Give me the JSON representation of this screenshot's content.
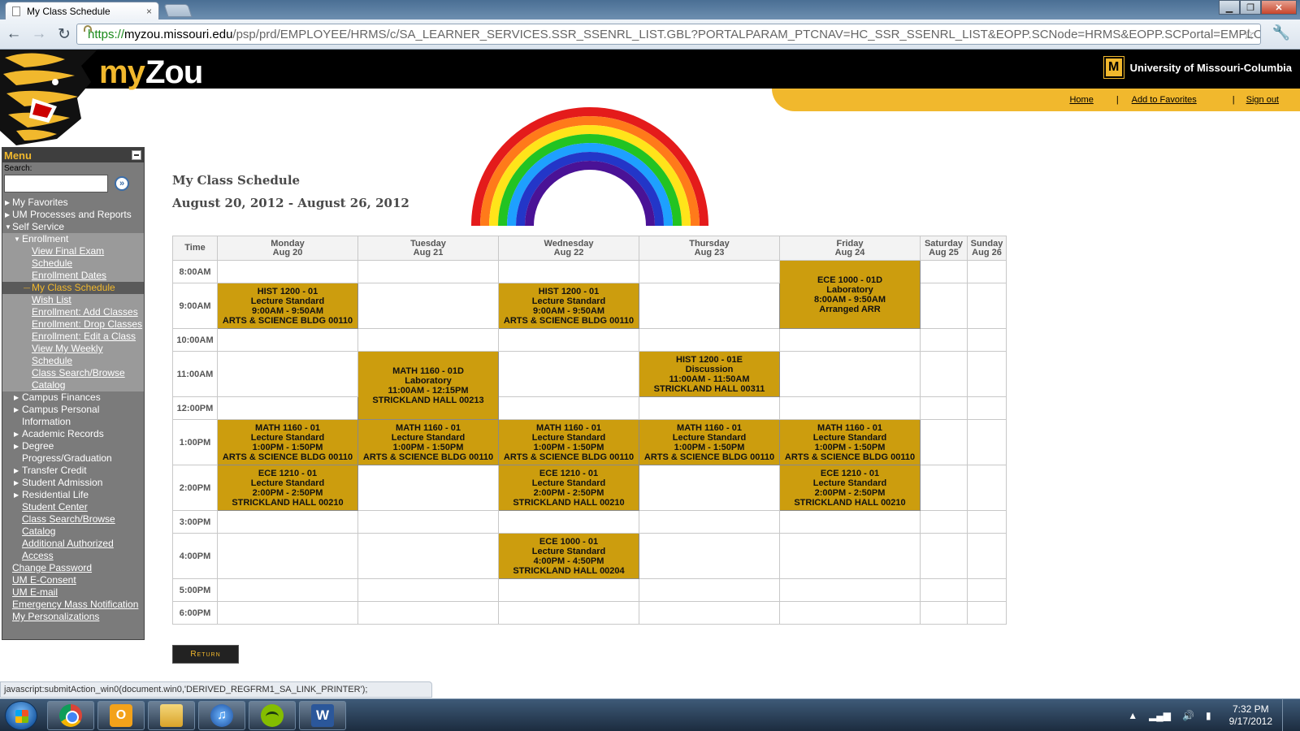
{
  "browser": {
    "tab_title": "My Class Schedule",
    "tab_close": "×",
    "url_scheme": "https://",
    "url_host": "myzou.missouri.edu",
    "url_path": "/psp/prd/EMPLOYEE/HRMS/c/SA_LEARNER_SERVICES.SSR_SSENRL_LIST.GBL?PORTALPARAM_PTCNAV=HC_SSR_SSENRL_LIST&EOPP.SCNode=HRMS&EOPP.SCPortal=EMPLOYEE&EOPP.SCN",
    "status_text": "javascript:submitAction_win0(document.win0,'DERIVED_REGFRM1_SA_LINK_PRINTER');"
  },
  "header": {
    "brand_my": "my",
    "brand_zou": "Zou",
    "university": "University of Missouri-Columbia",
    "links": [
      "Home",
      "Add to Favorites",
      "Sign out"
    ],
    "link_separator": "|"
  },
  "menu": {
    "title": "Menu",
    "search_label": "Search:",
    "items": [
      {
        "label": "My Favorites",
        "level": 0,
        "arrow": true,
        "style": "plain"
      },
      {
        "label": "UM Processes and Reports",
        "level": 0,
        "arrow": true,
        "style": "plain"
      },
      {
        "label": "Self Service",
        "level": 0,
        "arrow": true,
        "open": true,
        "style": "plain"
      },
      {
        "label": "Enrollment",
        "level": 1,
        "arrow": true,
        "open": true,
        "style": "plain",
        "sub": true
      },
      {
        "label": "View Final Exam Schedule",
        "level": 2,
        "style": "link",
        "sub": true
      },
      {
        "label": "Enrollment Dates",
        "level": 2,
        "style": "link",
        "sub": true
      },
      {
        "label": "My Class Schedule",
        "level": 2,
        "style": "current",
        "sub": true
      },
      {
        "label": "Wish List",
        "level": 2,
        "style": "link",
        "sub": true
      },
      {
        "label": "Enrollment: Add Classes",
        "level": 2,
        "style": "link",
        "sub": true
      },
      {
        "label": "Enrollment: Drop Classes",
        "level": 2,
        "style": "link",
        "sub": true
      },
      {
        "label": "Enrollment: Edit a Class",
        "level": 2,
        "style": "link",
        "sub": true
      },
      {
        "label": "View My Weekly Schedule",
        "level": 2,
        "style": "link",
        "sub": true
      },
      {
        "label": "Class Search/Browse Catalog",
        "level": 2,
        "style": "link",
        "sub": true
      },
      {
        "label": "Campus Finances",
        "level": 1,
        "arrow": true,
        "style": "plain"
      },
      {
        "label": "Campus Personal Information",
        "level": 1,
        "arrow": true,
        "style": "plain"
      },
      {
        "label": "Academic Records",
        "level": 1,
        "arrow": true,
        "style": "plain"
      },
      {
        "label": "Degree Progress/Graduation",
        "level": 1,
        "arrow": true,
        "style": "plain"
      },
      {
        "label": "Transfer Credit",
        "level": 1,
        "arrow": true,
        "style": "plain"
      },
      {
        "label": "Student Admission",
        "level": 1,
        "arrow": true,
        "style": "plain"
      },
      {
        "label": "Residential Life",
        "level": 1,
        "arrow": true,
        "style": "plain"
      },
      {
        "label": "Student Center",
        "level": 1,
        "style": "link"
      },
      {
        "label": "Class Search/Browse Catalog",
        "level": 1,
        "style": "link"
      },
      {
        "label": "Additional Authorized Access",
        "level": 1,
        "style": "link"
      },
      {
        "label": "Change Password",
        "level": 0,
        "style": "link"
      },
      {
        "label": "UM E-Consent",
        "level": 0,
        "style": "link"
      },
      {
        "label": "UM E-mail",
        "level": 0,
        "style": "link"
      },
      {
        "label": "Emergency Mass Notification",
        "level": 0,
        "style": "link"
      },
      {
        "label": "My Personalizations",
        "level": 0,
        "style": "link"
      }
    ]
  },
  "page": {
    "title": "My Class Schedule",
    "dates": "August 20, 2012 - August 26, 2012",
    "return_label": "Return"
  },
  "schedule": {
    "time_header": "Time",
    "days": [
      {
        "day": "Monday",
        "date": "Aug 20"
      },
      {
        "day": "Tuesday",
        "date": "Aug 21"
      },
      {
        "day": "Wednesday",
        "date": "Aug 22"
      },
      {
        "day": "Thursday",
        "date": "Aug 23"
      },
      {
        "day": "Friday",
        "date": "Aug 24"
      },
      {
        "day": "Saturday",
        "date": "Aug 25"
      },
      {
        "day": "Sunday",
        "date": "Aug 26"
      }
    ],
    "rows": [
      {
        "time": "8:00AM",
        "tall": false
      },
      {
        "time": "9:00AM",
        "tall": true
      },
      {
        "time": "10:00AM",
        "tall": false
      },
      {
        "time": "11:00AM",
        "tall": true
      },
      {
        "time": "12:00PM",
        "tall": false
      },
      {
        "time": "1:00PM",
        "tall": true
      },
      {
        "time": "2:00PM",
        "tall": true
      },
      {
        "time": "3:00PM",
        "tall": false
      },
      {
        "time": "4:00PM",
        "tall": true
      },
      {
        "time": "5:00PM",
        "tall": false
      },
      {
        "time": "6:00PM",
        "tall": false
      }
    ],
    "classes": [
      {
        "row": 1,
        "day": 0,
        "rowspan": 1,
        "lines": [
          "HIST 1200 - 01",
          "Lecture Standard",
          "9:00AM - 9:50AM",
          "ARTS & SCIENCE BLDG 00110"
        ]
      },
      {
        "row": 1,
        "day": 2,
        "rowspan": 1,
        "lines": [
          "HIST 1200 - 01",
          "Lecture Standard",
          "9:00AM - 9:50AM",
          "ARTS & SCIENCE BLDG 00110"
        ]
      },
      {
        "row": 0,
        "day": 4,
        "rowspan": 2,
        "lines": [
          "ECE 1000 - 01D",
          "Laboratory",
          "8:00AM - 9:50AM",
          "Arranged ARR"
        ]
      },
      {
        "row": 3,
        "day": 1,
        "rowspan": 2,
        "lines": [
          "MATH 1160 - 01D",
          "Laboratory",
          "11:00AM - 12:15PM",
          "STRICKLAND HALL 00213"
        ]
      },
      {
        "row": 3,
        "day": 3,
        "rowspan": 1,
        "lines": [
          "HIST 1200 - 01E",
          "Discussion",
          "11:00AM - 11:50AM",
          "STRICKLAND HALL 00311"
        ]
      },
      {
        "row": 5,
        "day": 0,
        "rowspan": 1,
        "lines": [
          "MATH 1160 - 01",
          "Lecture Standard",
          "1:00PM - 1:50PM",
          "ARTS & SCIENCE BLDG 00110"
        ]
      },
      {
        "row": 5,
        "day": 1,
        "rowspan": 1,
        "lines": [
          "MATH 1160 - 01",
          "Lecture Standard",
          "1:00PM - 1:50PM",
          "ARTS & SCIENCE BLDG 00110"
        ]
      },
      {
        "row": 5,
        "day": 2,
        "rowspan": 1,
        "lines": [
          "MATH 1160 - 01",
          "Lecture Standard",
          "1:00PM - 1:50PM",
          "ARTS & SCIENCE BLDG 00110"
        ]
      },
      {
        "row": 5,
        "day": 3,
        "rowspan": 1,
        "lines": [
          "MATH 1160 - 01",
          "Lecture Standard",
          "1:00PM - 1:50PM",
          "ARTS & SCIENCE BLDG 00110"
        ]
      },
      {
        "row": 5,
        "day": 4,
        "rowspan": 1,
        "lines": [
          "MATH 1160 - 01",
          "Lecture Standard",
          "1:00PM - 1:50PM",
          "ARTS & SCIENCE BLDG 00110"
        ]
      },
      {
        "row": 6,
        "day": 0,
        "rowspan": 1,
        "lines": [
          "ECE 1210 - 01",
          "Lecture Standard",
          "2:00PM - 2:50PM",
          "STRICKLAND HALL 00210"
        ]
      },
      {
        "row": 6,
        "day": 2,
        "rowspan": 1,
        "lines": [
          "ECE 1210 - 01",
          "Lecture Standard",
          "2:00PM - 2:50PM",
          "STRICKLAND HALL 00210"
        ]
      },
      {
        "row": 6,
        "day": 4,
        "rowspan": 1,
        "lines": [
          "ECE 1210 - 01",
          "Lecture Standard",
          "2:00PM - 2:50PM",
          "STRICKLAND HALL 00210"
        ]
      },
      {
        "row": 8,
        "day": 2,
        "rowspan": 1,
        "lines": [
          "ECE 1000 - 01",
          "Lecture Standard",
          "4:00PM - 4:50PM",
          "STRICKLAND HALL 00204"
        ]
      }
    ]
  },
  "taskbar": {
    "apps": [
      "chrome-icon",
      "outlook-icon",
      "folder-icon",
      "itunes-icon",
      "spotify-icon",
      "word-icon"
    ],
    "time": "7:32 PM",
    "date": "9/17/2012"
  },
  "colors": {
    "mizzou_gold": "#f1b82d",
    "class_block": "#cc9d0e",
    "menu_bg": "#7b7b7b"
  }
}
